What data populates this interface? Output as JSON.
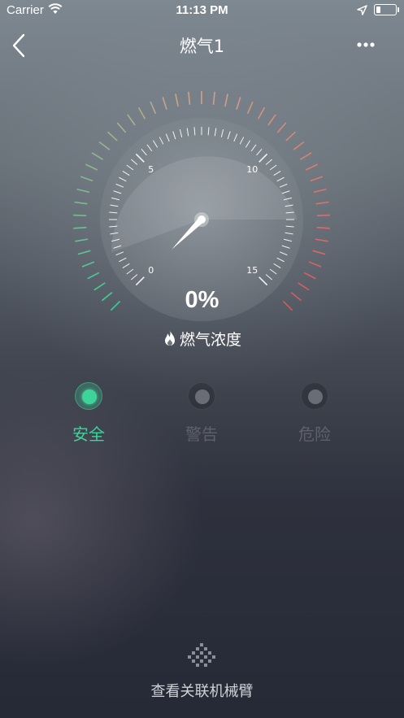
{
  "status_bar": {
    "carrier": "Carrier",
    "time": "11:13 PM",
    "battery_level": 0.25,
    "wifi_icon": "wifi-icon",
    "location_icon": "location-arrow-icon"
  },
  "nav": {
    "title": "燃气1",
    "back_icon": "chevron-left-icon",
    "more_icon": "more-dots-icon"
  },
  "gauge": {
    "min": 0,
    "max": 15,
    "major_tick_labels": [
      "0",
      "5",
      "10",
      "15"
    ],
    "reading": 0,
    "value_text": "0%",
    "label": "燃气浓度",
    "label_icon": "flame-icon",
    "colors": {
      "safe": "#3dd49a",
      "mid": "#d8a48a",
      "danger": "#e0575d"
    }
  },
  "levels": [
    {
      "label": "安全",
      "active": true,
      "color": "#3dd49a"
    },
    {
      "label": "警告",
      "active": false,
      "color": "#6a6d76"
    },
    {
      "label": "危险",
      "active": false,
      "color": "#6a6d76"
    }
  ],
  "footer_link": {
    "label": "查看关联机械臂",
    "icon": "expand-up-icon"
  }
}
